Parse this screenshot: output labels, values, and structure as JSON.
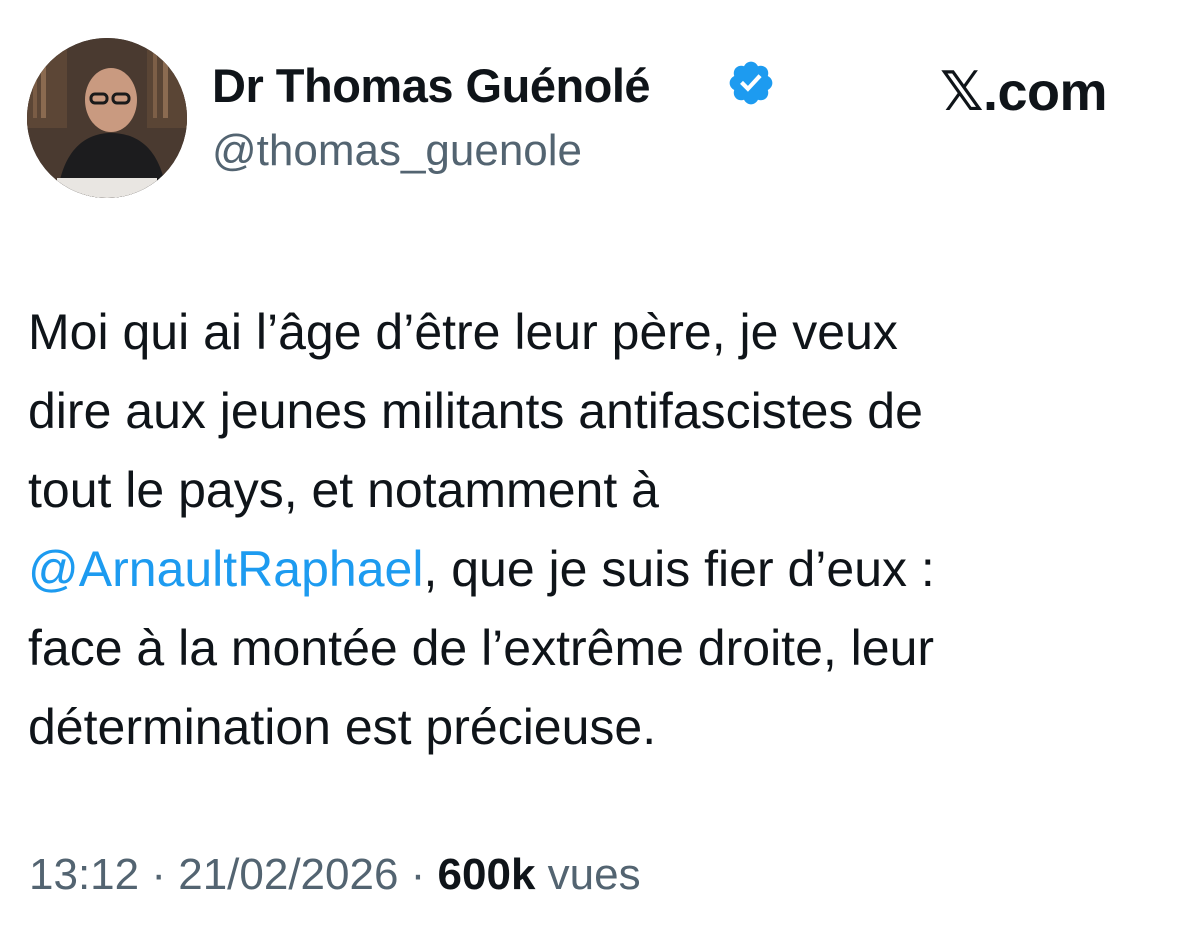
{
  "author": {
    "display_name": "Dr Thomas Guénolé",
    "handle": "@thomas_guenole",
    "verified": true,
    "verified_color": "#1d9bf0"
  },
  "brand": {
    "icon": "x-logo-icon",
    "text": ".com",
    "glyph": "𝕏"
  },
  "tweet": {
    "lines": [
      {
        "text": "Moi qui ai l’âge d’être leur père, je veux"
      },
      {
        "text": "dire aux jeunes militants antifascistes de"
      },
      {
        "text": "tout le pays, et notamment à"
      },
      {
        "mention": "@ArnaultRaphael",
        "text": ", que je suis fier d’eux :"
      },
      {
        "text": "face à la montée de l’extrême droite, leur"
      },
      {
        "text": "détermination est précieuse."
      }
    ],
    "mention_color": "#1d9bf0"
  },
  "meta": {
    "time": "13:12",
    "separator": " · ",
    "date": "21/02/2026",
    "views_count": "600k",
    "views_label": " vues"
  }
}
